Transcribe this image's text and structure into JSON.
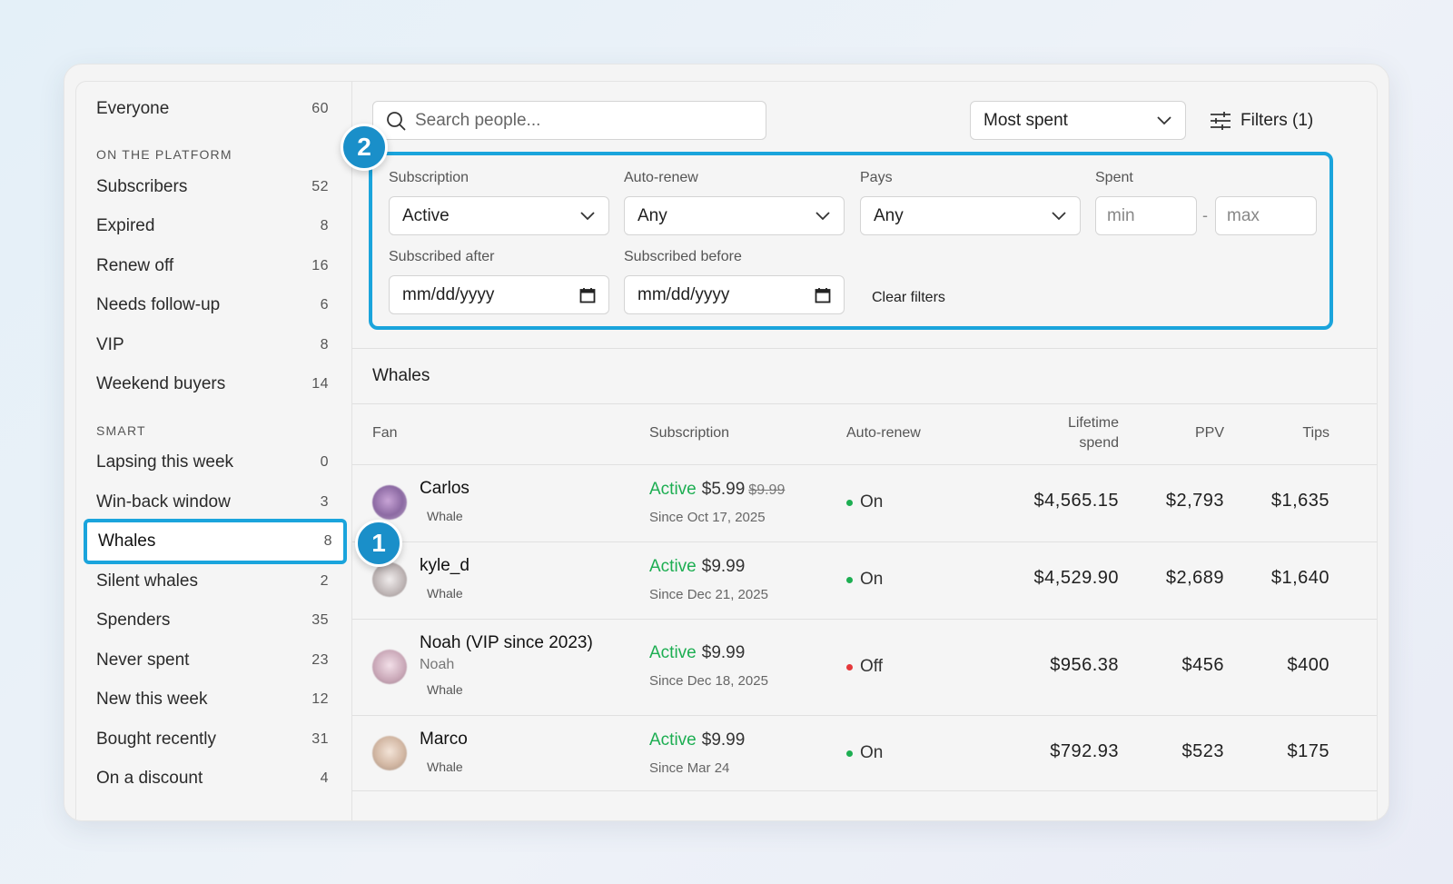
{
  "sidebar": {
    "everyone": {
      "label": "Everyone",
      "count": "60"
    },
    "section_platform": "ON THE PLATFORM",
    "platform": [
      {
        "label": "Subscribers",
        "count": "52"
      },
      {
        "label": "Expired",
        "count": "8"
      },
      {
        "label": "Renew off",
        "count": "16"
      },
      {
        "label": "Needs follow-up",
        "count": "6"
      },
      {
        "label": "VIP",
        "count": "8"
      },
      {
        "label": "Weekend buyers",
        "count": "14"
      }
    ],
    "section_smart": "SMART",
    "smart": [
      {
        "label": "Lapsing this week",
        "count": "0"
      },
      {
        "label": "Win-back window",
        "count": "3"
      },
      {
        "label": "Whales",
        "count": "8"
      },
      {
        "label": "Silent whales",
        "count": "2"
      },
      {
        "label": "Spenders",
        "count": "35"
      },
      {
        "label": "Never spent",
        "count": "23"
      },
      {
        "label": "New this week",
        "count": "12"
      },
      {
        "label": "Bought recently",
        "count": "31"
      },
      {
        "label": "On a discount",
        "count": "4"
      }
    ]
  },
  "toolbar": {
    "search_placeholder": "Search people...",
    "sort_value": "Most spent",
    "filters_label": "Filters (1)"
  },
  "filters": {
    "subscription": {
      "label": "Subscription",
      "value": "Active"
    },
    "auto_renew": {
      "label": "Auto-renew",
      "value": "Any"
    },
    "pays": {
      "label": "Pays",
      "value": "Any"
    },
    "spent": {
      "label": "Spent",
      "min_placeholder": "min",
      "max_placeholder": "max",
      "separator": "-"
    },
    "subscribed_after": {
      "label": "Subscribed after",
      "value": "mm/dd/yyyy"
    },
    "subscribed_before": {
      "label": "Subscribed before",
      "value": "mm/dd/yyyy"
    },
    "clear_label": "Clear filters"
  },
  "badges": {
    "one": "1",
    "two": "2"
  },
  "list": {
    "title": "Whales",
    "columns": {
      "fan": "Fan",
      "subscription": "Subscription",
      "auto_renew": "Auto-renew",
      "lifetime_1": "Lifetime",
      "lifetime_2": "spend",
      "ppv": "PPV",
      "tips": "Tips"
    },
    "rows": [
      {
        "name": "Carlos",
        "alias": "",
        "tag": "Whale",
        "status": "Active",
        "price": "$5.99",
        "old_price": "$9.99",
        "since": "Since Oct 17, 2025",
        "renew": "On",
        "lifetime": "$4,565.15",
        "ppv": "$2,793",
        "tips": "$1,635"
      },
      {
        "name": "kyle_d",
        "alias": "",
        "tag": "Whale",
        "status": "Active",
        "price": "$9.99",
        "old_price": "",
        "since": "Since Dec 21, 2025",
        "renew": "On",
        "lifetime": "$4,529.90",
        "ppv": "$2,689",
        "tips": "$1,640"
      },
      {
        "name": "Noah (VIP since 2023)",
        "alias": "Noah",
        "tag": "Whale",
        "status": "Active",
        "price": "$9.99",
        "old_price": "",
        "since": "Since Dec 18, 2025",
        "renew": "Off",
        "lifetime": "$956.38",
        "ppv": "$456",
        "tips": "$400"
      },
      {
        "name": "Marco",
        "alias": "",
        "tag": "Whale",
        "status": "Active",
        "price": "$9.99",
        "old_price": "",
        "since": "Since Mar 24",
        "renew": "On",
        "lifetime": "$792.93",
        "ppv": "$523",
        "tips": "$175"
      }
    ]
  },
  "colors": {
    "accent": "#1aa4dc",
    "badge": "#1a8fc9",
    "active": "#1dae52",
    "on": "#1dae52",
    "off": "#e5383b"
  }
}
